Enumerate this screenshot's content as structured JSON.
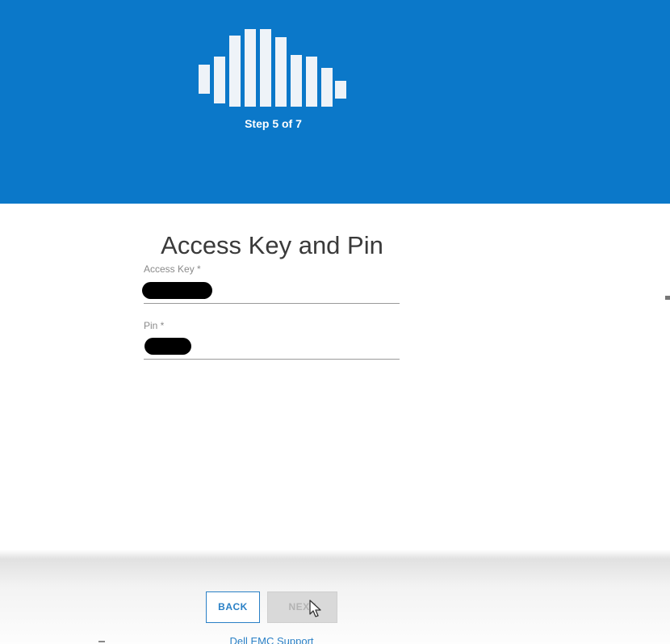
{
  "header": {
    "background_color": "#0b78c9",
    "logo_icon": "sound-wave-logo",
    "step_label": "Step 5 of 7"
  },
  "form": {
    "title": "Access Key and Pin",
    "fields": [
      {
        "label": "Access Key *",
        "value_state": "redacted"
      },
      {
        "label": "Pin *",
        "value_state": "redacted"
      }
    ]
  },
  "footer": {
    "back_label": "BACK",
    "next_label": "NEXT",
    "next_state": "disabled",
    "support_link": "Dell EMC Support"
  },
  "colors": {
    "accent": "#2a80c6",
    "header": "#0b78c9",
    "disabled_button": "#d9d9d9"
  }
}
